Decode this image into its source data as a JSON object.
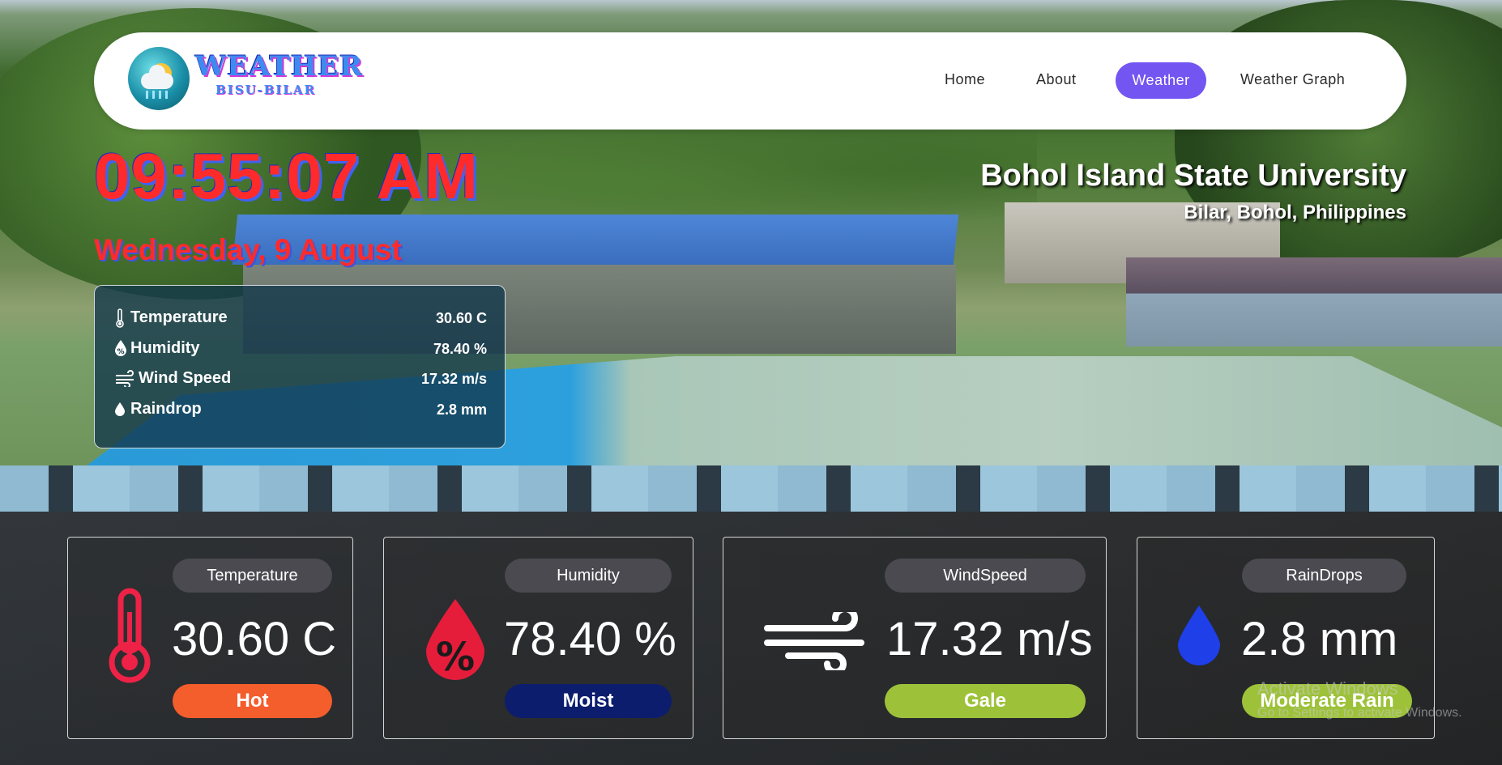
{
  "brand": {
    "title": "WEATHER",
    "subtitle": "BISU-BILAR"
  },
  "nav": {
    "items": [
      "Home",
      "About",
      "Weather",
      "Weather Graph"
    ],
    "active": "Weather",
    "active_color": "#7355f2"
  },
  "clock": {
    "time": "09:55:07 AM",
    "date": "Wednesday, 9 August"
  },
  "location": {
    "name": "Bohol Island State University",
    "place": "Bilar, Bohol, Philippines"
  },
  "summary": [
    {
      "icon": "thermometer-icon",
      "label": "Temperature",
      "value": "30.60 C"
    },
    {
      "icon": "humidity-icon",
      "label": "Humidity",
      "value": "78.40 %"
    },
    {
      "icon": "wind-icon",
      "label": "Wind Speed",
      "value": "17.32 m/s"
    },
    {
      "icon": "raindrop-icon",
      "label": "Raindrop",
      "value": "2.8 mm"
    }
  ],
  "cards": {
    "temperature": {
      "title": "Temperature",
      "value": "30.60 C",
      "status": "Hot",
      "status_color": "#f45d2c",
      "icon": "thermometer-icon",
      "icon_color": "#ee2247"
    },
    "humidity": {
      "title": "Humidity",
      "value": "78.40 %",
      "status": "Moist",
      "status_color": "#0c1d6e",
      "icon": "humidity-icon",
      "icon_color": "#e51d3b"
    },
    "windspeed": {
      "title": "WindSpeed",
      "value": "17.32 m/s",
      "status": "Gale",
      "status_color": "#9dc23a",
      "icon": "wind-icon",
      "icon_color": "#ffffff"
    },
    "raindrops": {
      "title": "RainDrops",
      "value": "2.8 mm",
      "status": "Moderate Rain",
      "status_color": "#9dc23a",
      "icon": "raindrop-icon",
      "icon_color": "#1f3fe8"
    }
  },
  "watermark": {
    "line1": "Activate Windows",
    "line2": "Go to Settings to activate Windows."
  }
}
